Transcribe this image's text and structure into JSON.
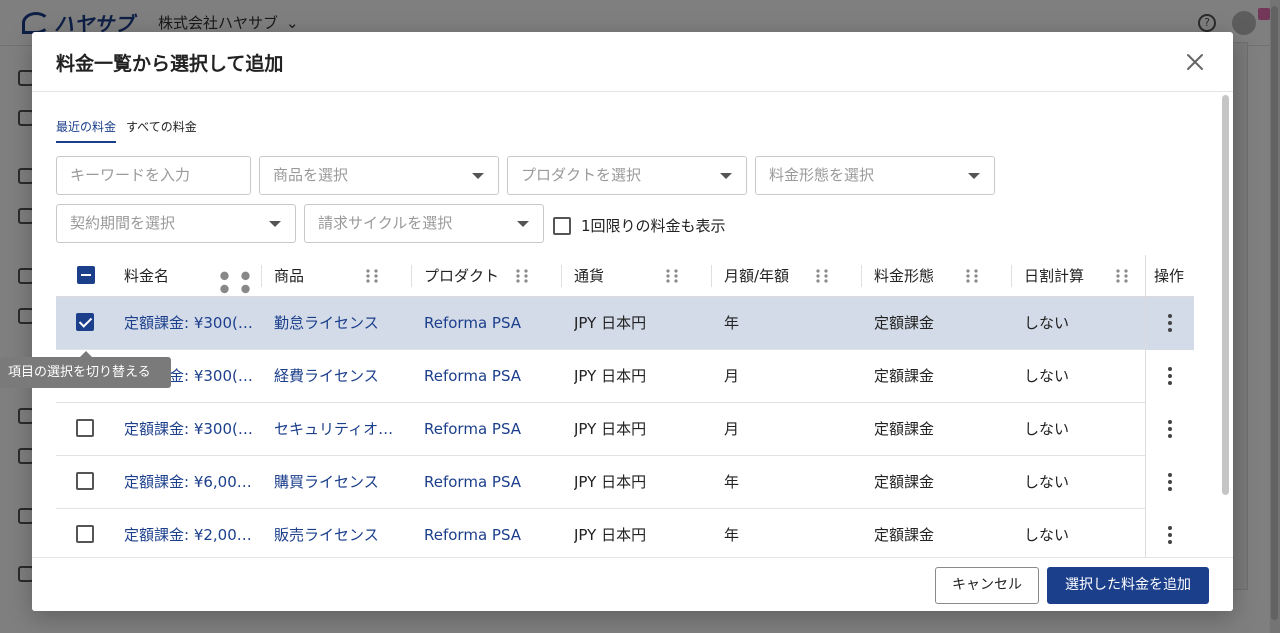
{
  "app": {
    "logo_text": "ハヤサブ",
    "company_name": "株式会社ハヤサブ"
  },
  "modal": {
    "title": "料金一覧から選択して追加",
    "tabs": [
      {
        "label": "最近の料金",
        "active": true
      },
      {
        "label": "すべての料金",
        "active": false
      }
    ],
    "filters": {
      "keyword_placeholder": "キーワードを入力",
      "product_item_placeholder": "商品を選択",
      "product_placeholder": "プロダクトを選択",
      "pricing_type_placeholder": "料金形態を選択",
      "contract_period_placeholder": "契約期間を選択",
      "billing_cycle_placeholder": "請求サイクルを選択",
      "one_time_label": "1回限りの料金も表示"
    },
    "columns": [
      "料金名",
      "商品",
      "プロダクト",
      "通貨",
      "月額/年額",
      "料金形態",
      "日割計算",
      "操作"
    ],
    "rows": [
      {
        "selected": true,
        "name": "定額課金: ¥300(…",
        "item": "勤怠ライセンス",
        "product": "Reforma PSA",
        "currency": "JPY 日本円",
        "period": "年",
        "type": "定額課金",
        "prorate": "しない"
      },
      {
        "selected": false,
        "name": "定額課金: ¥300(…",
        "item": "経費ライセンス",
        "product": "Reforma PSA",
        "currency": "JPY 日本円",
        "period": "月",
        "type": "定額課金",
        "prorate": "しない"
      },
      {
        "selected": false,
        "name": "定額課金: ¥300(…",
        "item": "セキュリティオ…",
        "product": "Reforma PSA",
        "currency": "JPY 日本円",
        "period": "月",
        "type": "定額課金",
        "prorate": "しない"
      },
      {
        "selected": false,
        "name": "定額課金: ¥6,000…",
        "item": "購買ライセンス",
        "product": "Reforma PSA",
        "currency": "JPY 日本円",
        "period": "年",
        "type": "定額課金",
        "prorate": "しない"
      },
      {
        "selected": false,
        "name": "定額課金: ¥2,000…",
        "item": "販売ライセンス",
        "product": "Reforma PSA",
        "currency": "JPY 日本円",
        "period": "年",
        "type": "定額課金",
        "prorate": "しない"
      }
    ],
    "tooltip": "項目の選択を切り替える",
    "footer": {
      "cancel_label": "キャンセル",
      "add_label": "選択した料金を追加"
    }
  },
  "colors": {
    "brand": "#1c3f8c",
    "selected_row": "#d3dbe8"
  }
}
